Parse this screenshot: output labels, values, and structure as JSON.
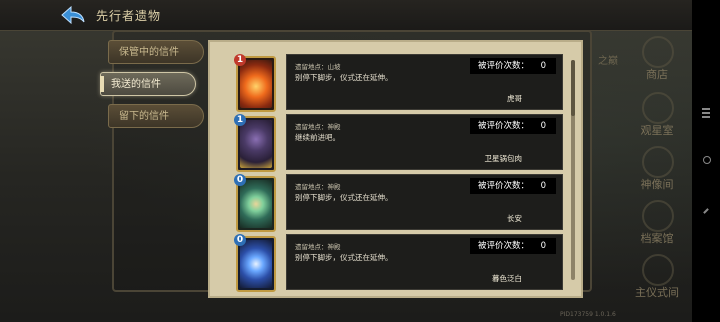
{
  "header": {
    "title": "先行者遗物"
  },
  "tabs": [
    {
      "label": "保管中的信件",
      "active": false
    },
    {
      "label": "我送的信件",
      "active": true
    },
    {
      "label": "留下的信件",
      "active": false
    }
  ],
  "side_cutoff_text": "之巅",
  "right_menu": [
    {
      "label": "商店",
      "icon": "shop-emblem-icon"
    },
    {
      "label": "观星室",
      "icon": "star-emblem-icon"
    },
    {
      "label": "神像间",
      "icon": "statue-emblem-icon"
    },
    {
      "label": "档案馆",
      "icon": "archive-emblem-icon"
    },
    {
      "label": "主仪式间",
      "icon": "ritual-emblem-icon"
    }
  ],
  "letters": [
    {
      "card_cost": "1",
      "cost_color": "#c0392b",
      "card_icon": "fire-card-icon",
      "location": "遗留地点：山坡",
      "message": "别停下脚步，仪式还在延伸。",
      "rating_label": "被评价次数：",
      "rating_value": "0",
      "sender": "虎哥"
    },
    {
      "card_cost": "1",
      "cost_color": "#2e6fb5",
      "card_icon": "dark-armor-card-icon",
      "location": "遗留地点：神殿",
      "message": "继续前进吧。",
      "rating_label": "被评价次数：",
      "rating_value": "0",
      "sender": "卫星锅包肉"
    },
    {
      "card_cost": "0",
      "cost_color": "#2e6fb5",
      "card_icon": "spiral-card-icon",
      "location": "遗留地点：神殿",
      "message": "别停下脚步，仪式还在延伸。",
      "rating_label": "被评价次数：",
      "rating_value": "0",
      "sender": "长安"
    },
    {
      "card_cost": "0",
      "cost_color": "#2e6fb5",
      "card_icon": "lightning-card-icon",
      "location": "遗留地点：神殿",
      "message": "别停下脚步，仪式还在延伸。",
      "rating_label": "被评价次数：",
      "rating_value": "0",
      "sender": "暮色泛白"
    }
  ],
  "version": "PID173759 1.0.1.6"
}
